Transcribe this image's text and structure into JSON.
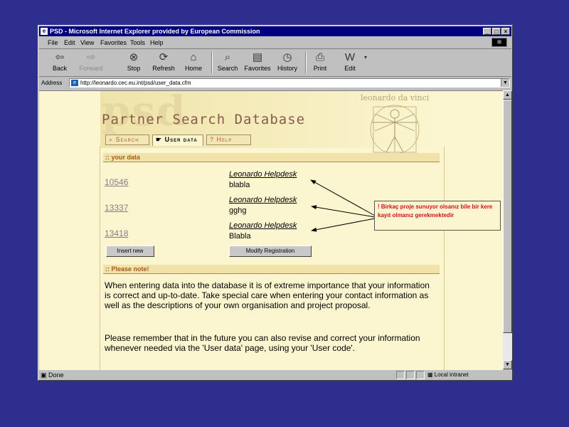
{
  "window": {
    "title": "PSD - Microsoft Internet Explorer provided by European Commission",
    "controls": [
      "_",
      "□",
      "×"
    ]
  },
  "menu": [
    "File",
    "Edit",
    "View",
    "Favorites",
    "Tools",
    "Help"
  ],
  "toolbar": {
    "back": "Back",
    "forward": "Forward",
    "stop": "Stop",
    "refresh": "Refresh",
    "home": "Home",
    "search": "Search",
    "favorites": "Favorites",
    "history": "History",
    "print": "Print",
    "edit": "Edit"
  },
  "address": {
    "label": "Address",
    "url": "http://leonardo.cec.eu.int/psd/user_data.cfm"
  },
  "page": {
    "logo_text": "psd",
    "leonardo_label": "leonardo da vinci",
    "title": "Partner Search Database",
    "tabs": {
      "search": "Search",
      "user_data": "User data",
      "help": "Help"
    },
    "your_data_heading": ":: your data",
    "entries": [
      {
        "code": "10546",
        "helpdesk": "Leonardo Helpdesk",
        "desc": "blabla"
      },
      {
        "code": "13337",
        "helpdesk": "Leonardo Helpdesk",
        "desc": "gghg"
      },
      {
        "code": "13418",
        "helpdesk": "Leonardo Helpdesk",
        "desc": "Blabla"
      }
    ],
    "insert_button": "Insert new",
    "modify_button": "Modify Registration",
    "note_heading": ":: Please note!",
    "note_p1": "When entering data into the database it is of extreme importance that your information is correct and up-to-date. Take special care when entering your contact information as well as the descriptions of your own organisation and project proposal.",
    "note_p2": "Please remember that in the future you can also revise and correct your information whenever needed via the 'User data' page, using your 'User code'."
  },
  "callout": "! Birkaç proje sunuyor olsanız bile bir kere kayıt olmanız gerekmektedir",
  "status": {
    "done": "Done",
    "zone": "Local intranet"
  },
  "colors": {
    "slide_background": "#2e2e8e",
    "page_background": "#fbf6cf",
    "callout_text": "#d0101a",
    "title_text": "#8a5a4e"
  }
}
